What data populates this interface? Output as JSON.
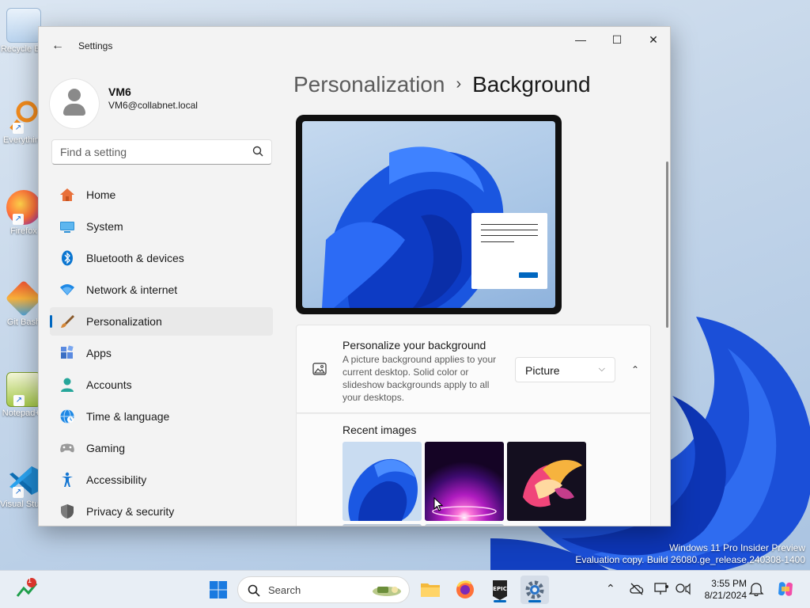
{
  "desktop": {
    "icons": [
      {
        "label": "Recycle Bin",
        "icon": "recycle-bin-icon"
      },
      {
        "label": "Everything",
        "icon": "magnifier-icon"
      },
      {
        "label": "Firefox",
        "icon": "firefox-icon"
      },
      {
        "label": "Git Bash",
        "icon": "git-icon"
      },
      {
        "label": "Notepad++",
        "icon": "notepad-plus-icon"
      },
      {
        "label": "Visual Studio Code",
        "icon": "vscode-icon"
      }
    ],
    "watermark_line1": "Windows 11 Pro Insider Preview",
    "watermark_line2": "Evaluation copy. Build 26080.ge_release.240308-1400"
  },
  "window": {
    "title": "Settings",
    "controls": {
      "minimize": "—",
      "maximize": "☐",
      "close": "✕"
    }
  },
  "profile": {
    "name": "VM6",
    "email": "VM6@collabnet.local"
  },
  "search": {
    "placeholder": "Find a setting"
  },
  "nav": [
    {
      "label": "Home",
      "icon": "home-icon",
      "color": "#e8703a"
    },
    {
      "label": "System",
      "icon": "system-icon",
      "color": "#2a8fd6"
    },
    {
      "label": "Bluetooth & devices",
      "icon": "bluetooth-icon",
      "color": "#0a75d0"
    },
    {
      "label": "Network & internet",
      "icon": "wifi-icon",
      "color": "#1e88e5"
    },
    {
      "label": "Personalization",
      "icon": "brush-icon",
      "color": "#d68838",
      "active": true
    },
    {
      "label": "Apps",
      "icon": "apps-icon",
      "color": "#3b6fc4"
    },
    {
      "label": "Accounts",
      "icon": "accounts-icon",
      "color": "#26a69a"
    },
    {
      "label": "Time & language",
      "icon": "globe-clock-icon",
      "color": "#1e88e5"
    },
    {
      "label": "Gaming",
      "icon": "gamepad-icon",
      "color": "#8a8a8a"
    },
    {
      "label": "Accessibility",
      "icon": "accessibility-icon",
      "color": "#1677d2"
    },
    {
      "label": "Privacy & security",
      "icon": "shield-icon",
      "color": "#6b6b6b"
    }
  ],
  "breadcrumb": {
    "parent": "Personalization",
    "separator": "›",
    "current": "Background"
  },
  "background_card": {
    "title": "Personalize your background",
    "description": "A picture background applies to your current desktop. Solid color or slideshow backgrounds apply to all your desktops.",
    "select_value": "Picture",
    "collapse_symbol": "⌃"
  },
  "recent_images": {
    "title": "Recent images"
  },
  "taskbar": {
    "search_label": "Search",
    "notification_badge": "1",
    "time": "3:55 PM",
    "date": "8/21/2024",
    "accent": "#0067c0"
  }
}
